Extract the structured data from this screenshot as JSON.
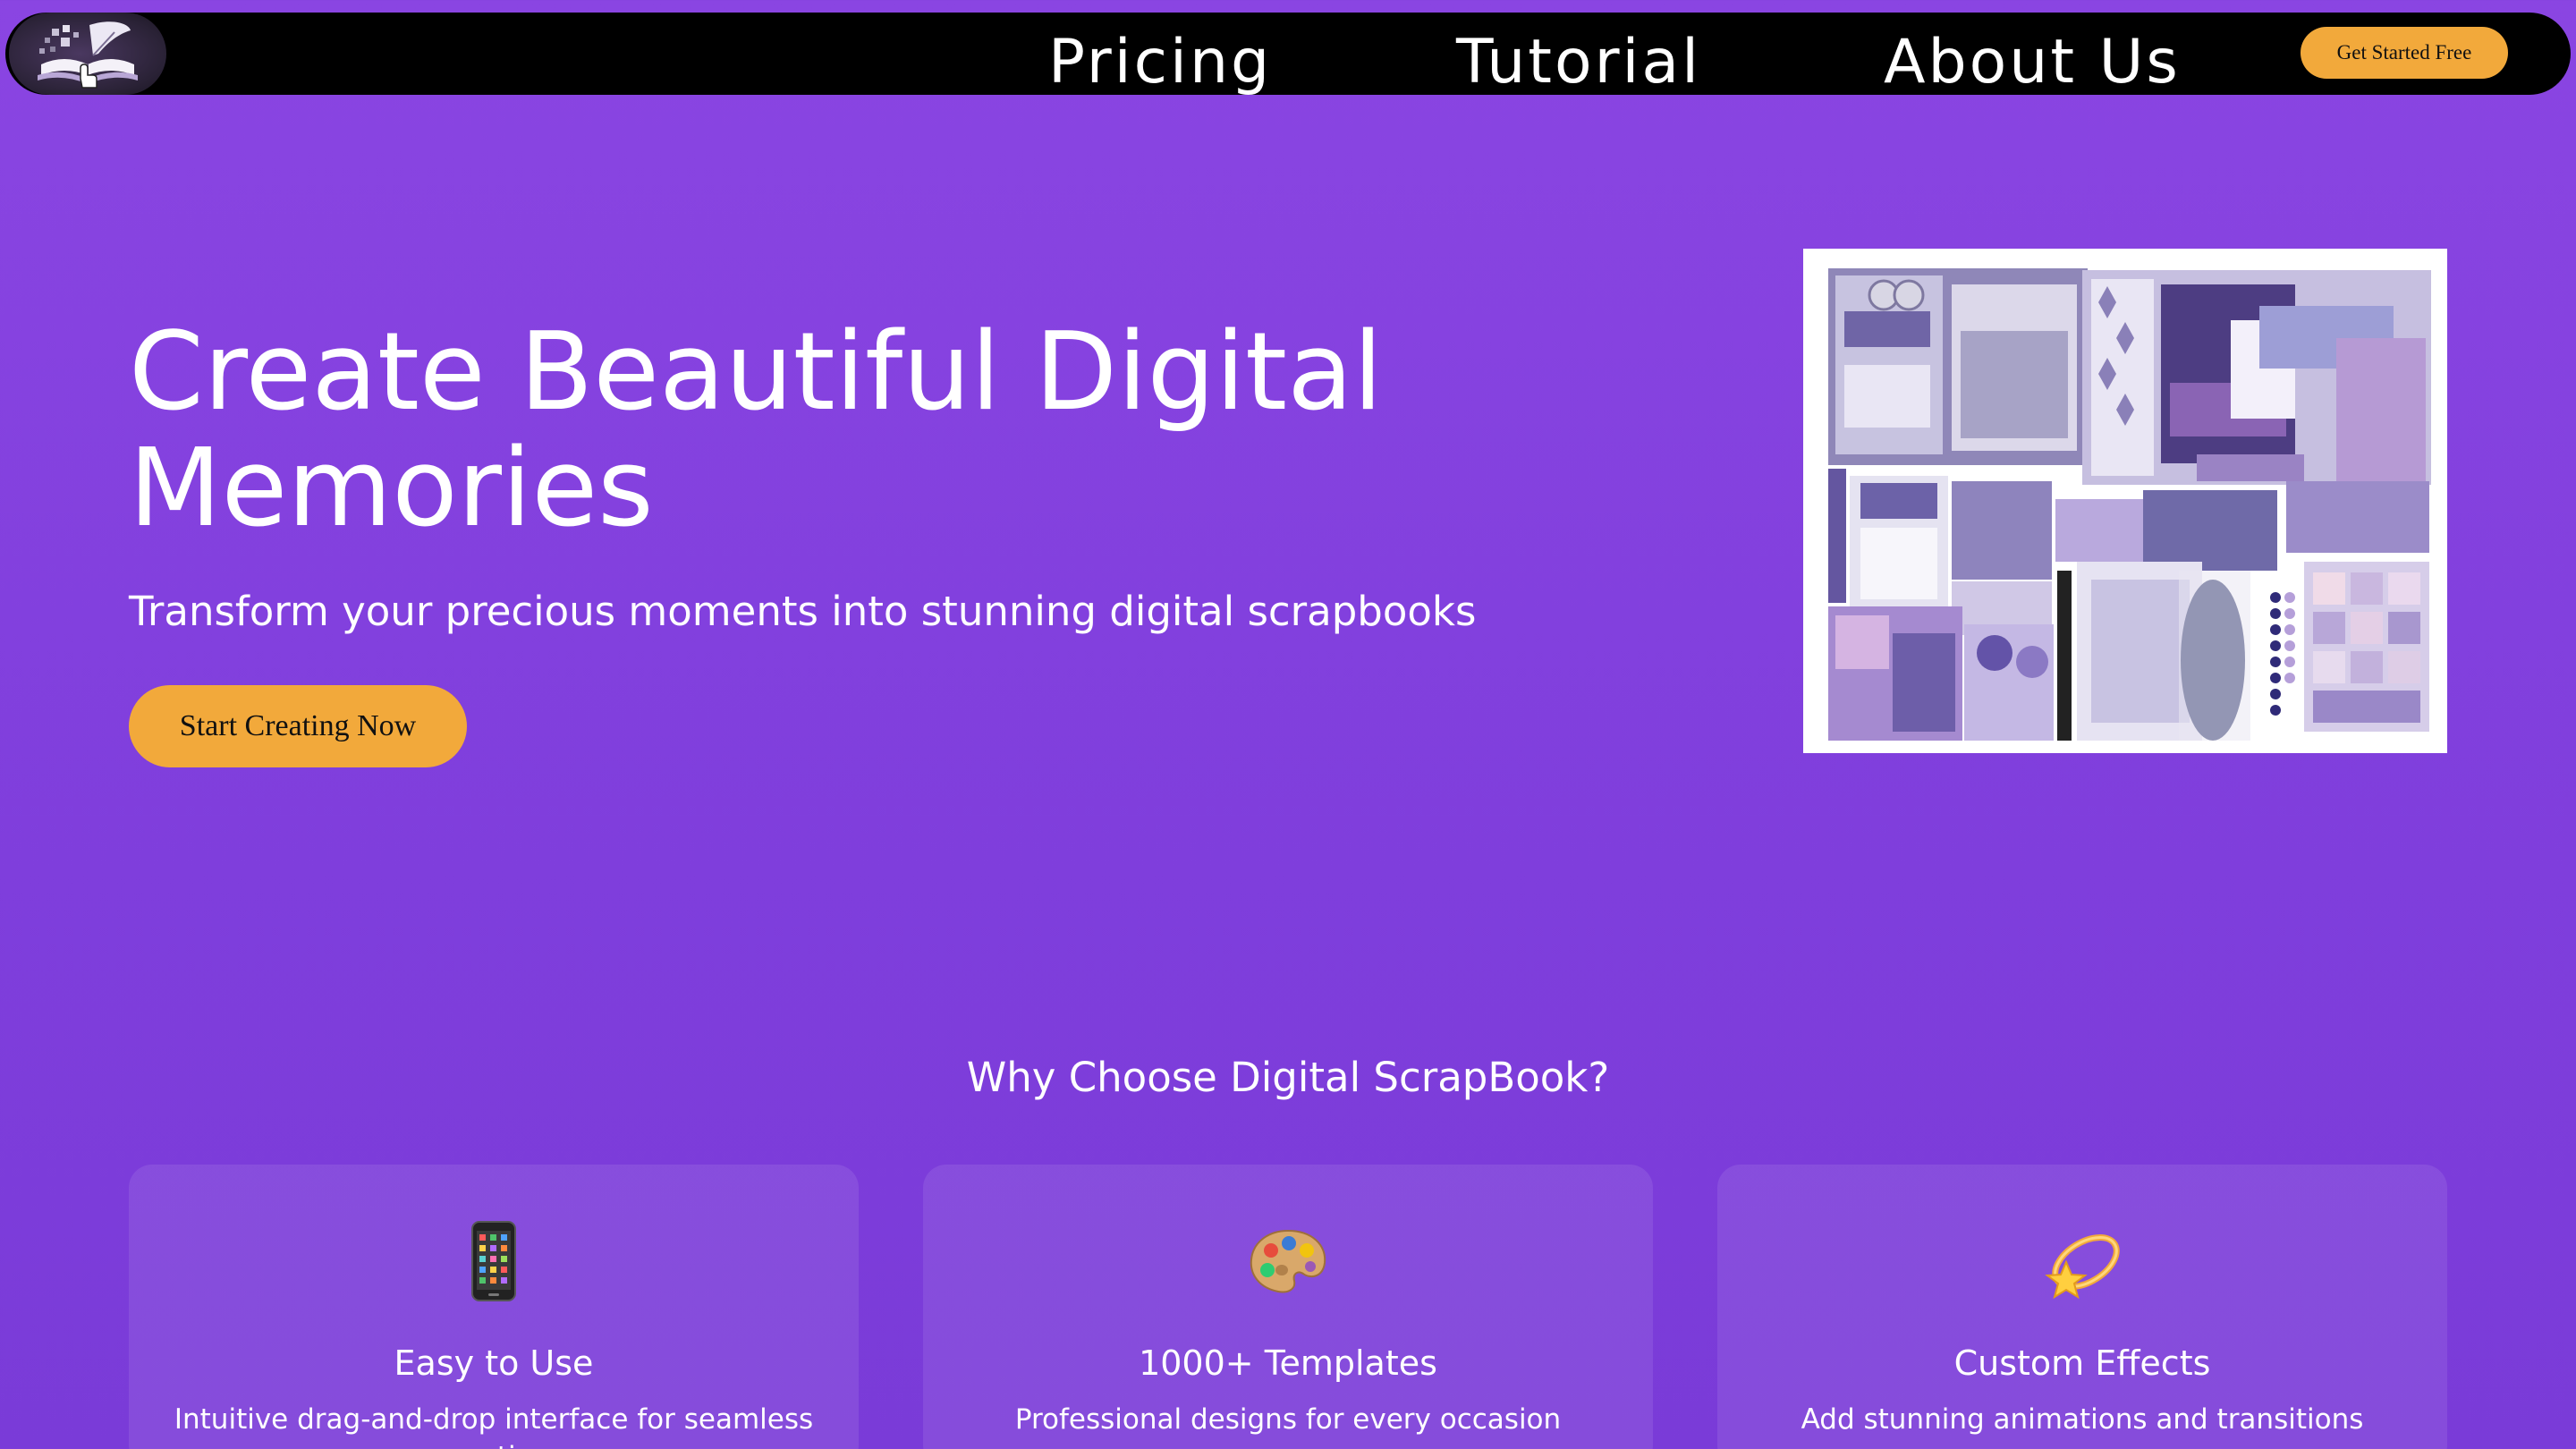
{
  "nav": {
    "logo_alt": "Digital ScrapBook logo",
    "links": [
      "Pricing",
      "Tutorial",
      "About Us"
    ],
    "cta_label": "Get Started Free"
  },
  "hero": {
    "title": "Create Beautiful Digital Memories",
    "subtitle": "Transform your precious moments into stunning digital scrapbooks",
    "cta_label": "Start Creating Now",
    "image_icon": "scrapbook-collage-image"
  },
  "features": {
    "heading": "Why Choose Digital ScrapBook?",
    "cards": [
      {
        "icon": "mobile-phone-icon",
        "title": "Easy to Use",
        "description": "Intuitive drag-and-drop interface for seamless creation"
      },
      {
        "icon": "palette-icon",
        "title": "1000+ Templates",
        "description": "Professional designs for every occasion"
      },
      {
        "icon": "dizzy-star-icon",
        "title": "Custom Effects",
        "description": "Add stunning animations and transitions"
      }
    ]
  },
  "colors": {
    "background": "#8a45e2",
    "navbar": "#000000",
    "accent": "#f2a93b",
    "text": "#ffffff"
  }
}
